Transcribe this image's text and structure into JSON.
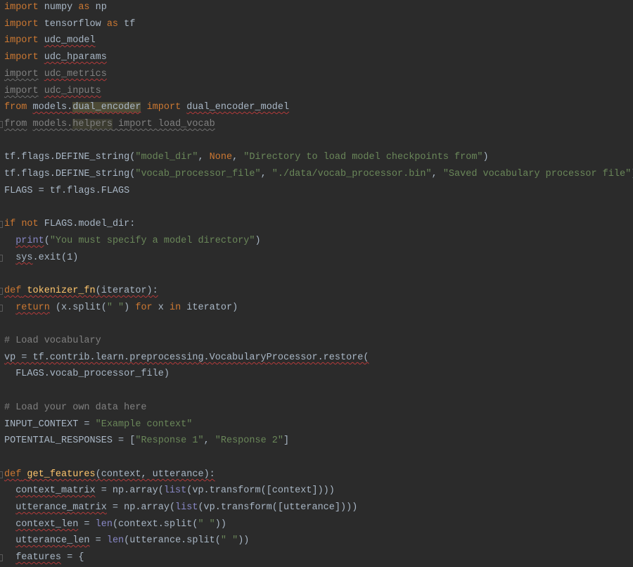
{
  "editor": {
    "language": "Python",
    "theme": "dark",
    "colors": {
      "background": "#2b2b2b",
      "text": "#a9b7c6",
      "keyword": "#cc7832",
      "string": "#6a8759",
      "comment": "#808080",
      "function_def": "#ffc66d",
      "builtin": "#8888c6",
      "error_underline": "#b33a3a"
    },
    "lines": [
      {
        "fold": false,
        "tokens": [
          [
            "kw",
            "import"
          ],
          [
            "tx",
            " numpy "
          ],
          [
            "kw",
            "as"
          ],
          [
            "tx",
            " np"
          ]
        ]
      },
      {
        "fold": false,
        "tokens": [
          [
            "kw",
            "import"
          ],
          [
            "tx",
            " tensorflow "
          ],
          [
            "kw",
            "as"
          ],
          [
            "tx",
            " tf"
          ]
        ]
      },
      {
        "fold": false,
        "tokens": [
          [
            "kw",
            "import"
          ],
          [
            "tx",
            " "
          ],
          [
            "tx",
            "udc_model",
            "wavy"
          ]
        ]
      },
      {
        "fold": false,
        "tokens": [
          [
            "kw",
            "import"
          ],
          [
            "tx",
            " "
          ],
          [
            "tx",
            "udc_hparams",
            "wavy"
          ]
        ]
      },
      {
        "fold": false,
        "tokens": [
          [
            "dim",
            "import",
            "wavy-gray"
          ],
          [
            "dim",
            " "
          ],
          [
            "dim",
            "udc_metrics",
            "wavy"
          ]
        ]
      },
      {
        "fold": false,
        "tokens": [
          [
            "dim",
            "import",
            "wavy-gray"
          ],
          [
            "dim",
            " "
          ],
          [
            "dim",
            "udc_inputs",
            "wavy"
          ]
        ]
      },
      {
        "fold": false,
        "tokens": [
          [
            "kw",
            "from"
          ],
          [
            "tx",
            " "
          ],
          [
            "tx",
            "models.",
            "wavy"
          ],
          [
            "tx",
            "dual_encoder",
            "wavy hl-usage"
          ],
          [
            "tx",
            " "
          ],
          [
            "kw",
            "import"
          ],
          [
            "tx",
            " "
          ],
          [
            "tx",
            "dual_encoder_model",
            "wavy"
          ]
        ]
      },
      {
        "fold": true,
        "tokens": [
          [
            "dim",
            "from",
            "wavy-gray"
          ],
          [
            "dim",
            " "
          ],
          [
            "dim",
            "models.",
            "wavy-gray"
          ],
          [
            "dim",
            "helpers",
            "wavy-gray hl-dim"
          ],
          [
            "dim",
            " import load_vocab",
            "wavy-gray"
          ]
        ]
      },
      {
        "fold": false,
        "tokens": []
      },
      {
        "fold": false,
        "tokens": [
          [
            "tx",
            "tf.flags.DEFINE_string("
          ],
          [
            "str",
            "\"model_dir\""
          ],
          [
            "tx",
            ", "
          ],
          [
            "kw",
            "None"
          ],
          [
            "tx",
            ", "
          ],
          [
            "str",
            "\"Directory to load model checkpoints from\""
          ],
          [
            "tx",
            ")"
          ]
        ]
      },
      {
        "fold": false,
        "tokens": [
          [
            "tx",
            "tf.flags.DEFINE_string("
          ],
          [
            "str",
            "\"vocab_processor_file\""
          ],
          [
            "tx",
            ", "
          ],
          [
            "str",
            "\"./data/vocab_processor.bin\""
          ],
          [
            "tx",
            ", "
          ],
          [
            "str",
            "\"Saved vocabulary processor file\""
          ],
          [
            "tx",
            ")"
          ]
        ]
      },
      {
        "fold": false,
        "tokens": [
          [
            "tx",
            "FLAGS = tf.flags.FLAGS"
          ]
        ]
      },
      {
        "fold": false,
        "tokens": []
      },
      {
        "fold": true,
        "tokens": [
          [
            "kw",
            "if"
          ],
          [
            "tx",
            " "
          ],
          [
            "kw",
            "not"
          ],
          [
            "tx",
            " FLAGS.model_dir:"
          ]
        ]
      },
      {
        "fold": false,
        "tokens": [
          [
            "tx",
            "  "
          ],
          [
            "bi",
            "print",
            "wavy"
          ],
          [
            "tx",
            "("
          ],
          [
            "str",
            "\"You must specify a model directory\""
          ],
          [
            "tx",
            ")"
          ]
        ]
      },
      {
        "fold": true,
        "tokens": [
          [
            "tx",
            "  "
          ],
          [
            "tx",
            "sys",
            "wavy"
          ],
          [
            "tx",
            ".exit(1)"
          ]
        ]
      },
      {
        "fold": false,
        "tokens": []
      },
      {
        "fold": true,
        "tokens": [
          [
            "kw",
            "def",
            "wavy"
          ],
          [
            "tx",
            " ",
            "wavy"
          ],
          [
            "fn",
            "tokenizer_fn",
            "wavy"
          ],
          [
            "tx",
            "(iterator):",
            "wavy"
          ]
        ]
      },
      {
        "fold": true,
        "tokens": [
          [
            "tx",
            "  "
          ],
          [
            "kw",
            "return",
            "wavy"
          ],
          [
            "tx",
            " (x.split("
          ],
          [
            "str",
            "\" \""
          ],
          [
            "tx",
            ") "
          ],
          [
            "kw",
            "for"
          ],
          [
            "tx",
            " x "
          ],
          [
            "kw",
            "in"
          ],
          [
            "tx",
            " iterator)"
          ]
        ]
      },
      {
        "fold": false,
        "tokens": []
      },
      {
        "fold": false,
        "tokens": [
          [
            "cm",
            "# Load vocabulary"
          ]
        ]
      },
      {
        "fold": false,
        "tokens": [
          [
            "tx",
            "vp = tf.contrib.learn.preprocessing.VocabularyProcessor.restore(",
            "wavy"
          ]
        ]
      },
      {
        "fold": false,
        "tokens": [
          [
            "tx",
            "  FLAGS.vocab_processor_file)"
          ]
        ]
      },
      {
        "fold": false,
        "tokens": []
      },
      {
        "fold": false,
        "tokens": [
          [
            "cm",
            "# Load your own data here"
          ]
        ]
      },
      {
        "fold": false,
        "tokens": [
          [
            "tx",
            "INPUT_CONTEXT = "
          ],
          [
            "str",
            "\"Example context\""
          ]
        ]
      },
      {
        "fold": false,
        "tokens": [
          [
            "tx",
            "POTENTIAL_RESPONSES = ["
          ],
          [
            "str",
            "\"Response 1\""
          ],
          [
            "tx",
            ", "
          ],
          [
            "str",
            "\"Response 2\""
          ],
          [
            "tx",
            "]"
          ]
        ]
      },
      {
        "fold": false,
        "tokens": []
      },
      {
        "fold": true,
        "tokens": [
          [
            "kw",
            "def",
            "wavy"
          ],
          [
            "tx",
            " ",
            "wavy"
          ],
          [
            "fn",
            "get_features",
            "wavy"
          ],
          [
            "tx",
            "(context, utterance):",
            "wavy"
          ]
        ]
      },
      {
        "fold": false,
        "tokens": [
          [
            "tx",
            "  "
          ],
          [
            "tx",
            "context_matrix",
            "wavy"
          ],
          [
            "tx",
            " = np.array("
          ],
          [
            "bi",
            "list"
          ],
          [
            "tx",
            "(vp.transform([context])))"
          ]
        ]
      },
      {
        "fold": false,
        "tokens": [
          [
            "tx",
            "  "
          ],
          [
            "tx",
            "utterance_matrix",
            "wavy"
          ],
          [
            "tx",
            " = np.array("
          ],
          [
            "bi",
            "list"
          ],
          [
            "tx",
            "(vp.transform([utterance])))"
          ]
        ]
      },
      {
        "fold": false,
        "tokens": [
          [
            "tx",
            "  "
          ],
          [
            "tx",
            "context_len",
            "wavy"
          ],
          [
            "tx",
            " = "
          ],
          [
            "bi",
            "len"
          ],
          [
            "tx",
            "(context.split("
          ],
          [
            "str",
            "\" \""
          ],
          [
            "tx",
            "))"
          ]
        ]
      },
      {
        "fold": false,
        "tokens": [
          [
            "tx",
            "  "
          ],
          [
            "tx",
            "utterance_len",
            "wavy"
          ],
          [
            "tx",
            " = "
          ],
          [
            "bi",
            "len"
          ],
          [
            "tx",
            "(utterance.split("
          ],
          [
            "str",
            "\" \""
          ],
          [
            "tx",
            "))"
          ]
        ]
      },
      {
        "fold": true,
        "tokens": [
          [
            "tx",
            "  "
          ],
          [
            "tx",
            "features",
            "wavy"
          ],
          [
            "tx",
            " = {"
          ]
        ]
      }
    ]
  }
}
